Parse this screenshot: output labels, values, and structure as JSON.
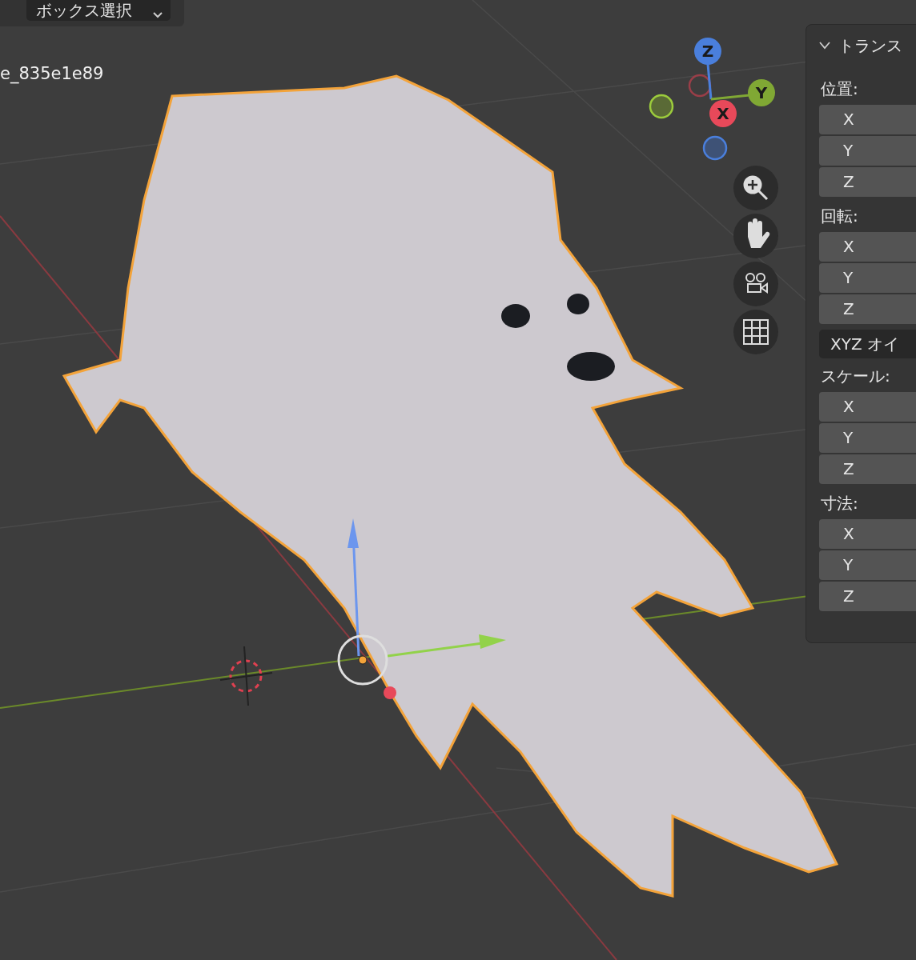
{
  "header": {
    "select_mode": "ボックス選択"
  },
  "viewport": {
    "object_name": "e_835e1e89"
  },
  "gizmo": {
    "axes": [
      {
        "label": "Z",
        "color": "#4a7fdc"
      },
      {
        "label": "Y",
        "color": "#80a834"
      },
      {
        "label": "X",
        "color": "#e8495a"
      }
    ]
  },
  "panel": {
    "title": "トランス",
    "expanded": true,
    "sections": [
      {
        "kind": "fields",
        "label": "位置:",
        "fields": [
          "X",
          "Y",
          "Z"
        ]
      },
      {
        "kind": "fields",
        "label": "回転:",
        "fields": [
          "X",
          "Y",
          "Z"
        ]
      },
      {
        "kind": "dropdown",
        "value": "XYZ オイ"
      },
      {
        "kind": "fields",
        "label": "スケール:",
        "fields": [
          "X",
          "Y",
          "Z"
        ]
      },
      {
        "kind": "fields",
        "label": "寸法:",
        "fields": [
          "X",
          "Y",
          "Z"
        ]
      }
    ]
  }
}
